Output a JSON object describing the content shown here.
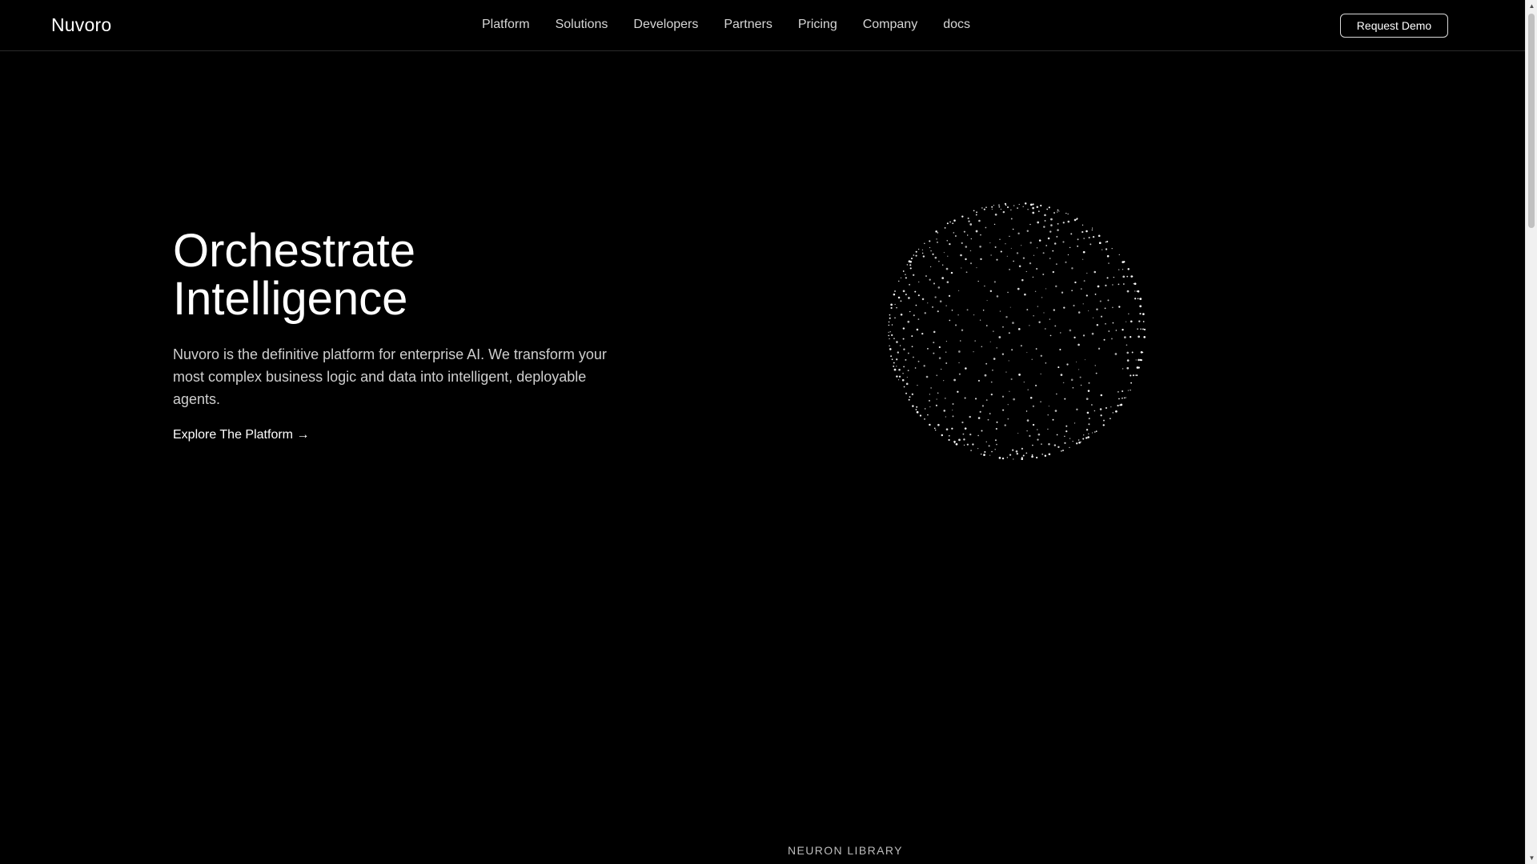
{
  "header": {
    "brand": "Nuvoro",
    "nav": [
      "Platform",
      "Solutions",
      "Developers",
      "Partners",
      "Pricing",
      "Company",
      "docs"
    ],
    "cta_label": "Request Demo"
  },
  "hero": {
    "title_line1": "Orchestrate",
    "title_line2": "Intelligence",
    "description": "Nuvoro is the definitive platform for enterprise AI. We transform your most complex business logic and data into intelligent, deployable agents.",
    "cta_label": "Explore The Platform →"
  },
  "sections": {
    "next_label": "NEURON LIBRARY"
  },
  "colors": {
    "background": "#000000",
    "text": "#ffffff",
    "muted_text": "#cfcfcf",
    "nav_text": "#d6d6d6",
    "border": "#2a2a2a"
  },
  "icons": {
    "globe": "dotted-sphere-graphic",
    "scroll_up": "triangle-up-icon",
    "scroll_down": "triangle-down-icon"
  }
}
